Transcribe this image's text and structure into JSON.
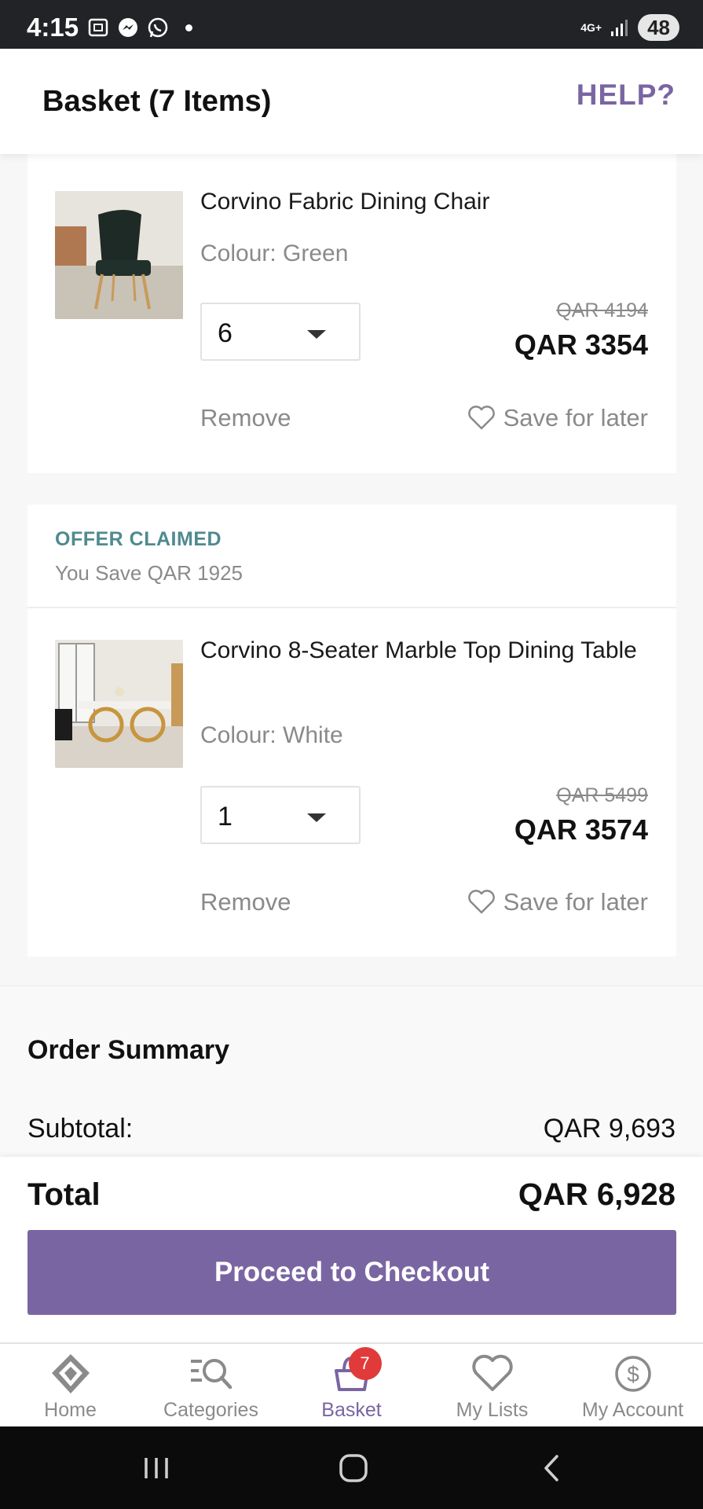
{
  "status_bar": {
    "time": "4:15",
    "network": "4G+",
    "battery": "48"
  },
  "header": {
    "title": "Basket (7 Items)",
    "help": "HELP?"
  },
  "items": [
    {
      "name": "Corvino Fabric Dining Chair",
      "colour": "Colour: Green",
      "quantity": "6",
      "old_price": "QAR 4194",
      "price": "QAR 3354",
      "remove": "Remove",
      "save_later": "Save for later"
    },
    {
      "name": "Corvino 8-Seater Marble Top Dining Table",
      "colour": "Colour: White",
      "quantity": "1",
      "old_price": "QAR 5499",
      "price": "QAR 3574",
      "remove": "Remove",
      "save_later": "Save for later"
    }
  ],
  "offer": {
    "title": "OFFER CLAIMED",
    "subtitle": "You Save QAR 1925"
  },
  "summary": {
    "title": "Order Summary",
    "subtotal_label": "Subtotal:",
    "subtotal_value": "QAR 9,693"
  },
  "total": {
    "label": "Total",
    "value": "QAR 6,928"
  },
  "checkout_label": "Proceed to Checkout",
  "tabs": [
    {
      "label": "Home",
      "icon": "home-logo-icon"
    },
    {
      "label": "Categories",
      "icon": "categories-search-icon"
    },
    {
      "label": "Basket",
      "icon": "basket-icon",
      "badge": "7",
      "active": true
    },
    {
      "label": "My Lists",
      "icon": "heart-icon"
    },
    {
      "label": "My Account",
      "icon": "account-icon"
    }
  ],
  "colors": {
    "accent": "#7a65a3",
    "offer": "#4f8a8f",
    "badge": "#e03a3a"
  }
}
